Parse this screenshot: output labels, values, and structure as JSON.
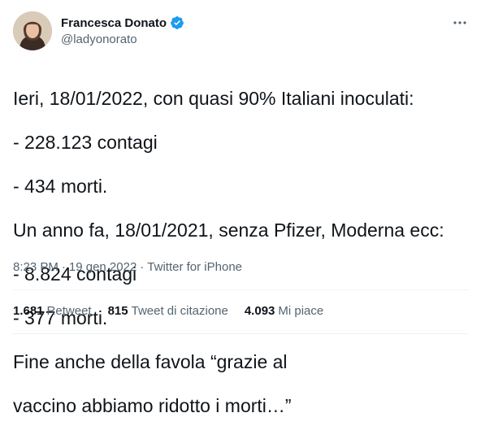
{
  "author": {
    "display_name": "Francesca Donato",
    "handle": "@ladyonorato",
    "verified": true
  },
  "tweet": {
    "lines": [
      "Ieri, 18/01/2022, con quasi 90% Italiani inoculati:",
      "- 228.123 contagi",
      "- 434 morti.",
      "Un anno fa, 18/01/2021, senza Pfizer, Moderna ecc:",
      "- 8.824 contagi",
      "- 377 morti.",
      "Fine anche della favola “grazie al",
      "vaccino abbiamo ridotto i morti…”"
    ]
  },
  "meta": {
    "time": "8:23 PM",
    "separator": "·",
    "date": "19 gen 2022",
    "separator2": "·",
    "source": "Twitter for iPhone"
  },
  "stats": [
    {
      "count": "1.681",
      "label": "Retweet"
    },
    {
      "count": "815",
      "label": "Tweet di citazione"
    },
    {
      "count": "4.093",
      "label": "Mi piace"
    }
  ],
  "colors": {
    "verified": "#1d9bf0",
    "text": "#0f1419",
    "secondary": "#536471",
    "divider": "#eff3f4"
  },
  "icons": {
    "verified": "verified-badge-icon",
    "more": "more-horizontal-icon"
  }
}
